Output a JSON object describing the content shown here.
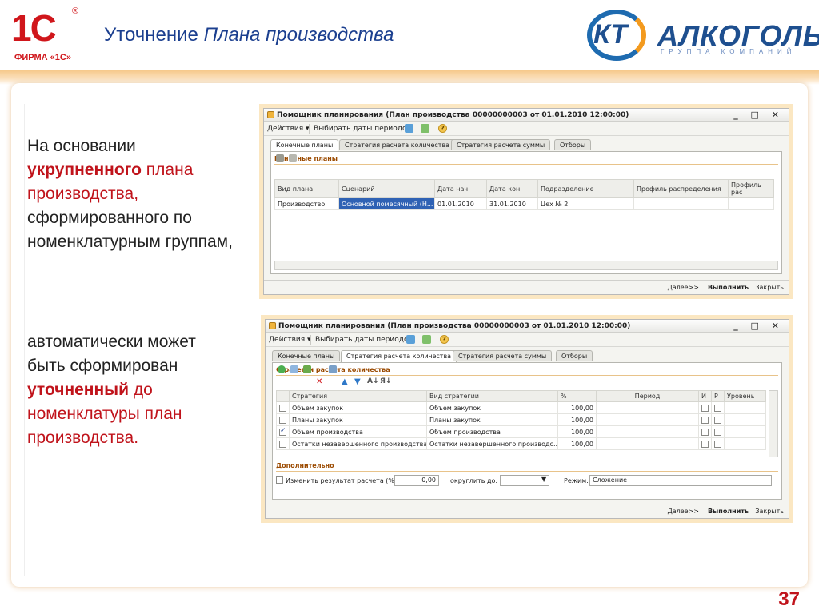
{
  "header": {
    "logo_1c_mark": "1С",
    "logo_1c_text": "ФИРМА «1С»",
    "logo_reg": "®",
    "title_plain": "Уточнение ",
    "title_italic": "Плана производства",
    "kt_letters": "КТ",
    "kt_word": "АЛКОГОЛЬ",
    "kt_sub": "ГРУППА КОМПАНИЙ"
  },
  "text": {
    "p1_line1": "На основании",
    "p1_bold": "укрупненного",
    "p1_after_bold": " плана",
    "p1_red": "производства,",
    "p1_rest": "сформированного по номенклатурным группам,",
    "p2_line": "автоматически может быть сформирован",
    "p2_bold": "уточненный",
    "p2_red_after": " до номенклатуры план производства."
  },
  "page_number": "37",
  "window1": {
    "title": "Помощник планирования (План производства 00000000003 от 01.01.2010 12:00:00)",
    "controls": "_ □ ✕",
    "toolbar": {
      "actions": "Действия ▾",
      "choose_dates": "Выбирать даты периодом",
      "help": "?"
    },
    "tabs": [
      "Конечные планы",
      "Стратегия расчета количества",
      "Стратегия расчета суммы",
      "Отборы"
    ],
    "active_tab": 0,
    "section": "Конечные планы",
    "columns": [
      "Вид плана",
      "Сценарий",
      "Дата нач.",
      "Дата кон.",
      "Подразделение",
      "Профиль распределения",
      "Профиль рас"
    ],
    "rows": [
      [
        "Производство",
        "Основной помесячный (Н...",
        "01.01.2010",
        "31.01.2010",
        "Цех № 2",
        "",
        ""
      ]
    ],
    "footer": {
      "next": "Далее>>",
      "run": "Выполнить",
      "close": "Закрыть"
    }
  },
  "window2": {
    "title": "Помощник планирования (План производства 00000000003 от 01.01.2010 12:00:00)",
    "controls": "_ □ ✕",
    "toolbar": {
      "actions": "Действия ▾",
      "choose_dates": "Выбирать даты периодом",
      "help": "?"
    },
    "tabs": [
      "Конечные планы",
      "Стратегия расчета количества",
      "Стратегия расчета суммы",
      "Отборы"
    ],
    "active_tab": 1,
    "section": "Стратегии расчета количества",
    "columns": [
      "",
      "Стратегия",
      "Вид стратегии",
      "%",
      "Период",
      "И",
      "Р",
      "Уровень"
    ],
    "rows": [
      {
        "checked": false,
        "strategy": "Объем закупок",
        "kind": "Объем закупок",
        "pct": "100,00"
      },
      {
        "checked": false,
        "strategy": "Планы закупок",
        "kind": "Планы закупок",
        "pct": "100,00"
      },
      {
        "checked": true,
        "strategy": "Объем производства",
        "kind": "Объем производства",
        "pct": "100,00"
      },
      {
        "checked": false,
        "strategy": "Остатки незавершенного производства",
        "kind": "Остатки незавершенного производс...",
        "pct": "100,00"
      }
    ],
    "extra_section": "Дополнительно",
    "change_result_label": "Изменить результат расчета (%):",
    "change_result_value": "0,00",
    "round_label": "округлить до:",
    "mode_label": "Режим:",
    "mode_value": "Сложение",
    "footer": {
      "next": "Далее>>",
      "run": "Выполнить",
      "close": "Закрыть"
    }
  }
}
